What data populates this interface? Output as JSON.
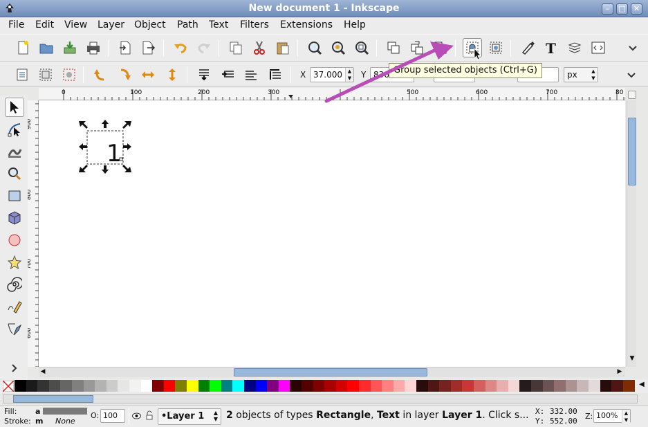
{
  "window": {
    "title": "New document 1 - Inkscape"
  },
  "menu": [
    "File",
    "Edit",
    "View",
    "Layer",
    "Object",
    "Path",
    "Text",
    "Filters",
    "Extensions",
    "Help"
  ],
  "toolbar_main": {
    "icons": [
      "new-document-icon",
      "open-icon",
      "import-icon",
      "print-icon",
      "import-bitmap-icon",
      "export-icon",
      "undo-icon",
      "redo-icon",
      "copy-icon",
      "cut-icon",
      "paste-icon",
      "zoom-selection-icon",
      "zoom-drawing-icon",
      "zoom-page-icon",
      "duplicate-icon",
      "clone-icon",
      "unlink-clone-icon",
      "group-icon",
      "ungroup-icon",
      "fill-stroke-icon",
      "text-font-icon",
      "layers-icon",
      "xml-editor-icon",
      "overflow-chevron-icon"
    ]
  },
  "toolbar_tool": {
    "x_label": "X",
    "x_value": "37.000",
    "y_label": "Y",
    "y_value": "836",
    "units": "px"
  },
  "tooltip": {
    "text": "Group selected objects (Ctrl+G)"
  },
  "ruler_h": [
    "0",
    "100",
    "200",
    "300",
    "500",
    "600",
    "700",
    "80"
  ],
  "ruler_v": [
    "900",
    "800",
    "700",
    "600"
  ],
  "canvas": {
    "text_object": "1"
  },
  "toolbox": [
    "selector-icon",
    "node-icon",
    "tweak-icon",
    "zoom-icon",
    "rectangle-icon",
    "3d-box-icon",
    "ellipse-icon",
    "star-icon",
    "spiral-icon",
    "pencil-icon",
    "pen-icon",
    "more-tools-icon"
  ],
  "palette_colors": [
    "#000000",
    "#1a1a1a",
    "#333333",
    "#4d4d4d",
    "#666666",
    "#808080",
    "#999999",
    "#b3b3b3",
    "#cccccc",
    "#e6e6e6",
    "#f2f2f2",
    "#ffffff",
    "#800000",
    "#ff0000",
    "#808000",
    "#ffff00",
    "#008000",
    "#00ff00",
    "#008080",
    "#00ffff",
    "#000080",
    "#0000ff",
    "#800080",
    "#ff00ff",
    "#2b0000",
    "#550000",
    "#800000",
    "#aa0000",
    "#d40000",
    "#ff0000",
    "#ff2a2a",
    "#ff5555",
    "#ff8080",
    "#ffaaaa",
    "#ffd5d5",
    "#280b0b",
    "#501616",
    "#782121",
    "#a02c2c",
    "#c83737",
    "#d35f5f",
    "#de8787",
    "#e9afaf",
    "#f4d7d7",
    "#241c1c",
    "#483737",
    "#6c5353",
    "#916f6f",
    "#ac9393",
    "#c8b7b7",
    "#e3dbdb",
    "#280b0b",
    "#501616",
    "#802b00"
  ],
  "status": {
    "fill_label": "Fill:",
    "fill_value": "a",
    "stroke_label": "Stroke:",
    "stroke_value": "m",
    "stroke_none": "None",
    "opacity_label": "O:",
    "opacity_value": "100",
    "layer": "•Layer 1",
    "message_count": "2",
    "message_a": " objects of types ",
    "message_type1": "Rectangle",
    "message_b": ", ",
    "message_type2": "Text",
    "message_c": " in layer ",
    "message_layer": "Layer 1",
    "message_d": ". Click s...",
    "x_label": "X:",
    "x_value": "332.00",
    "y_label": "Y:",
    "y_value": "552.00",
    "z_label": "Z:",
    "zoom_value": "100%"
  }
}
